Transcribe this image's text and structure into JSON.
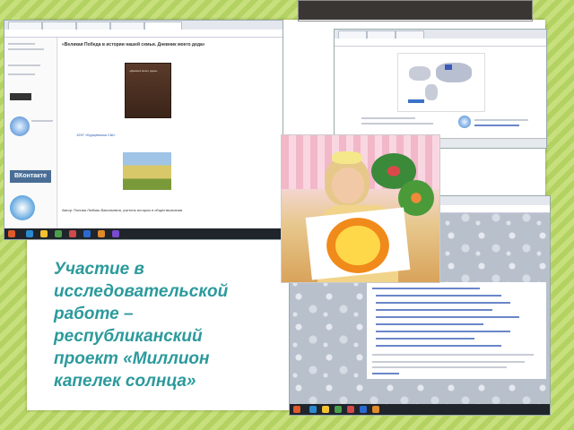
{
  "slide": {
    "caption": "Участие в исследовательской работе – республиканский проект «Миллион капелек солнца»"
  },
  "screenshot_left": {
    "article_title": "«Великая Победа в истории нашей семьи. Дневник моего деда»",
    "book_label": "«Дневник моего деда»",
    "link_text": "1937 «Бурцевская СШ»",
    "author_text": "Автор: Попова Любовь Васильевна, учитель истории и обществознания.",
    "sidebar_vk": "ВКонтакте"
  },
  "colors": {
    "caption": "#2c9a9c",
    "background": "#b9d86a",
    "slide": "#ffffff"
  }
}
